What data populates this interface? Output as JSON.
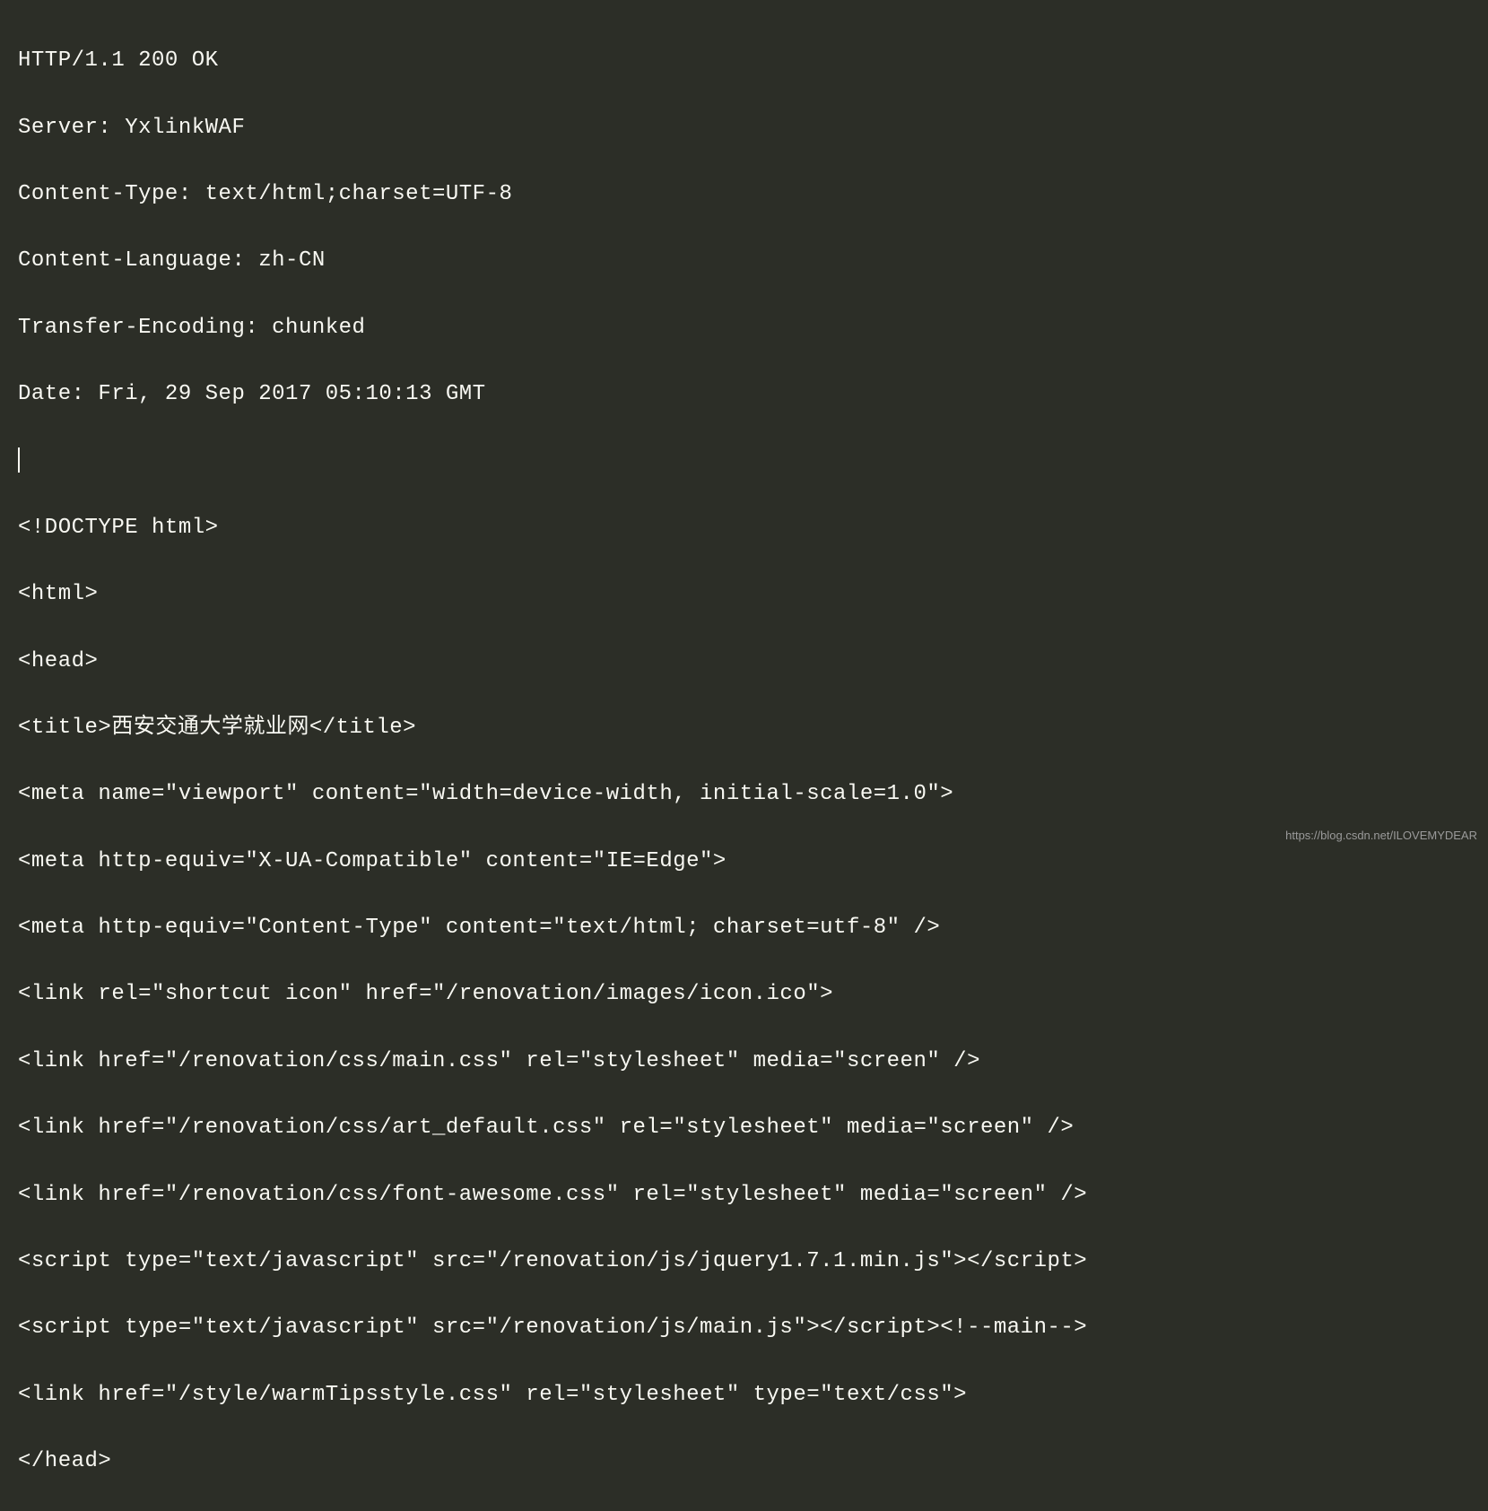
{
  "http_response": {
    "status_line": "HTTP/1.1 200 OK",
    "headers": {
      "server": "Server: YxlinkWAF",
      "content_type": "Content-Type: text/html;charset=UTF-8",
      "content_language": "Content-Language: zh-CN",
      "transfer_encoding": "Transfer-Encoding: chunked",
      "date": "Date: Fri, 29 Sep 2017 05:10:13 GMT"
    }
  },
  "html_body": {
    "doctype": "<!DOCTYPE html>",
    "html_open": "<html>",
    "head_open": "<head>",
    "title": "<title>西安交通大学就业网</title>",
    "meta_viewport": "<meta name=\"viewport\" content=\"width=device-width, initial-scale=1.0\">",
    "meta_xua": "<meta http-equiv=\"X-UA-Compatible\" content=\"IE=Edge\">",
    "meta_content_type": "<meta http-equiv=\"Content-Type\" content=\"text/html; charset=utf-8\" />",
    "link_icon": "<link rel=\"shortcut icon\" href=\"/renovation/images/icon.ico\">",
    "link_main_css": "<link href=\"/renovation/css/main.css\" rel=\"stylesheet\" media=\"screen\" />",
    "link_art_default": "<link href=\"/renovation/css/art_default.css\" rel=\"stylesheet\" media=\"screen\" />",
    "link_font_awesome": "<link href=\"/renovation/css/font-awesome.css\" rel=\"stylesheet\" media=\"screen\" />",
    "script_jquery": "<script type=\"text/javascript\" src=\"/renovation/js/jquery1.7.1.min.js\"></script>",
    "script_main": "<script type=\"text/javascript\" src=\"/renovation/js/main.js\"></script><!--main-->",
    "link_warmtips": "<link href=\"/style/warmTipsstyle.css\" rel=\"stylesheet\" type=\"text/css\">",
    "head_close": "</head>"
  },
  "watermark": "https://blog.csdn.net/ILOVEMYDEAR"
}
